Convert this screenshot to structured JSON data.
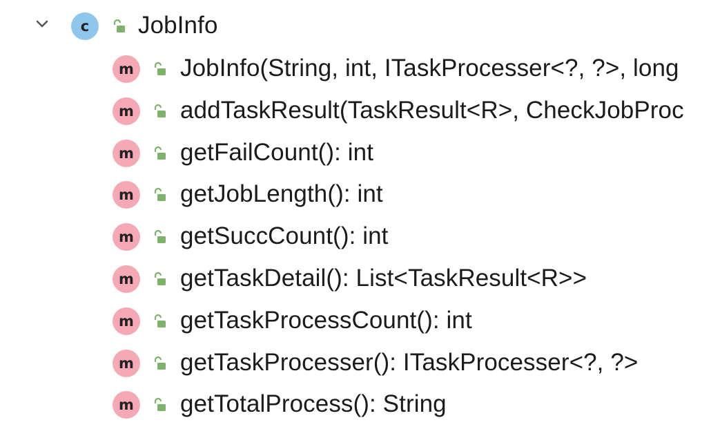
{
  "structure_tree": {
    "class_node": {
      "badge_letter": "c",
      "name": "JobInfo",
      "expanded": true,
      "icons": [
        "chevron-down-icon",
        "class-icon",
        "public-lock-icon"
      ]
    },
    "members": [
      {
        "badge_letter": "m",
        "signature": "JobInfo(String, int, ITaskProcesser<?, ?>, long"
      },
      {
        "badge_letter": "m",
        "signature": "addTaskResult(TaskResult<R>, CheckJobProc"
      },
      {
        "badge_letter": "m",
        "signature": "getFailCount(): int"
      },
      {
        "badge_letter": "m",
        "signature": "getJobLength(): int"
      },
      {
        "badge_letter": "m",
        "signature": "getSuccCount(): int"
      },
      {
        "badge_letter": "m",
        "signature": "getTaskDetail(): List<TaskResult<R>>"
      },
      {
        "badge_letter": "m",
        "signature": "getTaskProcessCount(): int"
      },
      {
        "badge_letter": "m",
        "signature": "getTaskProcesser(): ITaskProcesser<?, ?>"
      },
      {
        "badge_letter": "m",
        "signature": "getTotalProcess(): String"
      }
    ]
  },
  "colors": {
    "class_badge": "#8fc7ec",
    "method_badge": "#f4a9b5",
    "lock_icon": "#7fb36b",
    "text": "#1b1b1b",
    "background": "#ffffff"
  }
}
